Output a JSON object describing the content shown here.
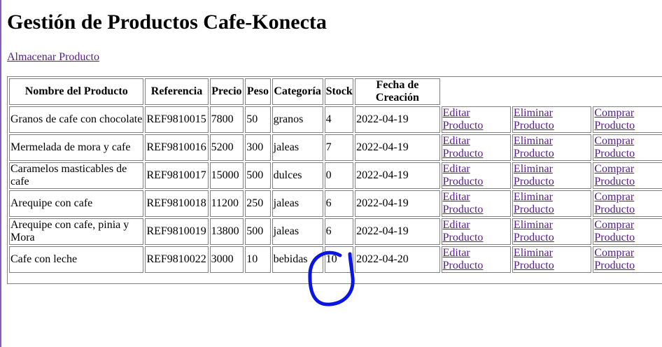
{
  "page": {
    "title": "Gestión de Productos Cafe-Konecta",
    "store_link": "Almacenar Producto"
  },
  "table": {
    "headers": [
      "Nombre del Producto",
      "Referencia",
      "Precio",
      "Peso",
      "Categoría",
      "Stock",
      "Fecha de Creación"
    ],
    "actions": {
      "edit": "Editar Producto",
      "delete": "Eliminar Producto",
      "buy": "Comprar Producto"
    },
    "rows": [
      {
        "name": "Granos de cafe con chocolate",
        "ref": "REF9810015",
        "price": "7800",
        "weight": "50",
        "category": "granos",
        "stock": "4",
        "date": "2022-04-19"
      },
      {
        "name": "Mermelada de mora y cafe",
        "ref": "REF9810016",
        "price": "5200",
        "weight": "300",
        "category": "jaleas",
        "stock": "7",
        "date": "2022-04-19"
      },
      {
        "name": "Caramelos masticables de cafe",
        "ref": "REF9810017",
        "price": "15000",
        "weight": "500",
        "category": "dulces",
        "stock": "0",
        "date": "2022-04-19"
      },
      {
        "name": "Arequipe con cafe",
        "ref": "REF9810018",
        "price": "11200",
        "weight": "250",
        "category": "jaleas",
        "stock": "6",
        "date": "2022-04-19"
      },
      {
        "name": "Arequipe con cafe, pinia y Mora",
        "ref": "REF9810019",
        "price": "13800",
        "weight": "500",
        "category": "jaleas",
        "stock": "6",
        "date": "2022-04-19"
      },
      {
        "name": "Cafe con leche",
        "ref": "REF9810022",
        "price": "3000",
        "weight": "10",
        "category": "bebidas",
        "stock": "10",
        "date": "2022-04-20"
      }
    ]
  },
  "annotation": {
    "color": "#0a14e6"
  }
}
